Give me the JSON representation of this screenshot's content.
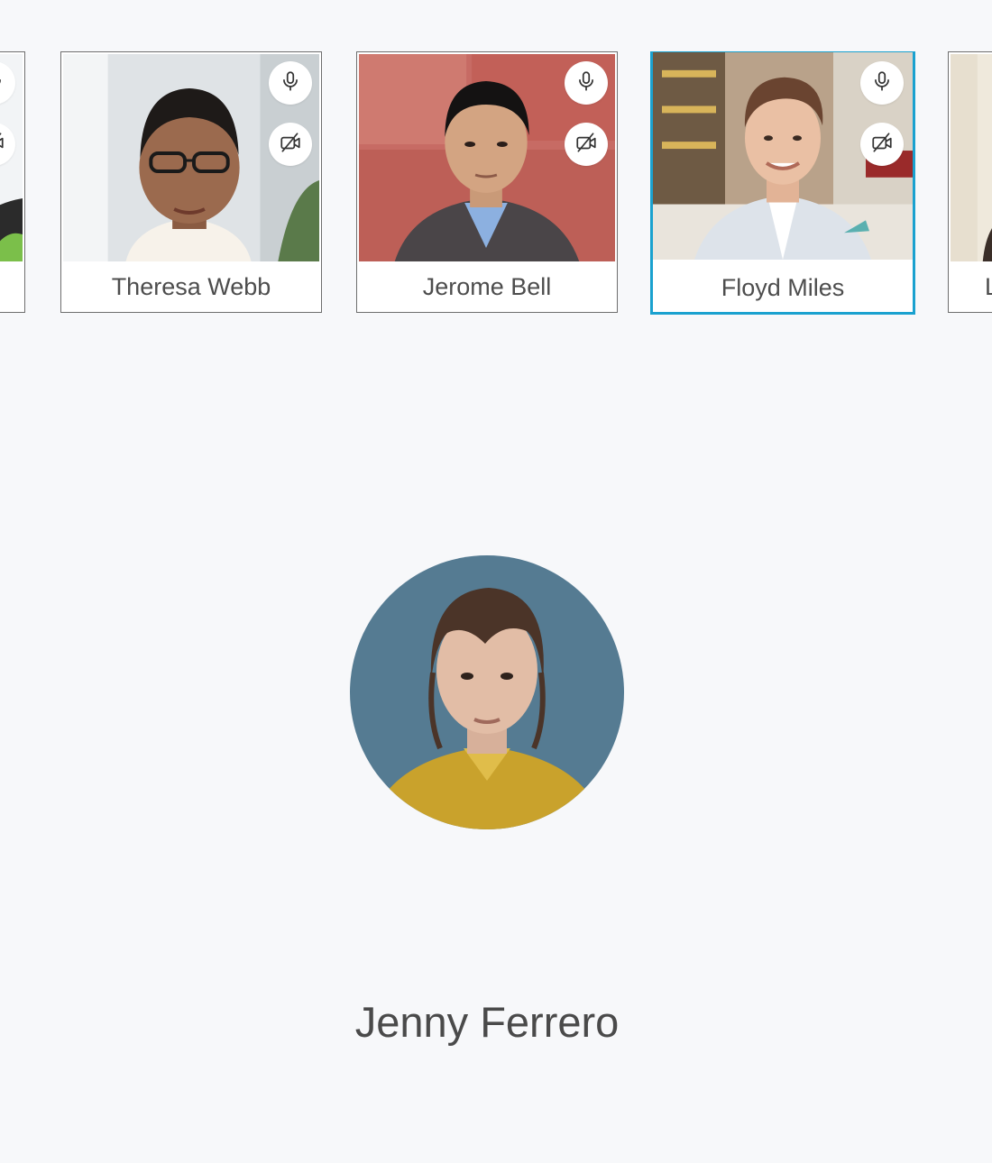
{
  "participants": [
    {
      "name": "",
      "selected": false
    },
    {
      "name": "Theresa Webb",
      "selected": false
    },
    {
      "name": "Jerome Bell",
      "selected": false
    },
    {
      "name": "Floyd Miles",
      "selected": true
    },
    {
      "name": "L",
      "selected": false
    }
  ],
  "spotlight": {
    "name": "Jenny Ferrero"
  },
  "icons": {
    "mic": "microphone-icon",
    "camera": "camera-off-icon"
  },
  "colors": {
    "background": "#f7f8fa",
    "selected_border": "#1aa1cf",
    "tile_border": "#6e6e6e",
    "text": "#4a4a4a"
  }
}
